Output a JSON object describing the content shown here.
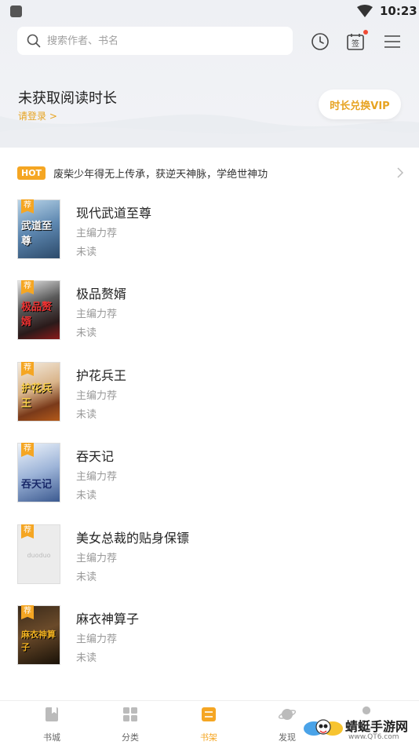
{
  "status_bar": {
    "time": "10:23"
  },
  "search": {
    "placeholder": "搜索作者、书名"
  },
  "checkin_icon_label": "签",
  "reading": {
    "title": "未获取阅读时长",
    "login": "请登录 >",
    "vip_button": "时长兑换VIP"
  },
  "hot": {
    "badge": "HOT",
    "text": "废柴少年得无上传承，获逆天神脉，学绝世神功"
  },
  "books": [
    {
      "title": "现代武道至尊",
      "subtitle": "主编力荐",
      "status": "未读",
      "tag": "荐",
      "cover_text": "武道至尊"
    },
    {
      "title": "极品赘婿",
      "subtitle": "主编力荐",
      "status": "未读",
      "tag": "荐",
      "cover_text": "极品赘婿"
    },
    {
      "title": "护花兵王",
      "subtitle": "主编力荐",
      "status": "未读",
      "tag": "荐",
      "cover_text": "护花兵王"
    },
    {
      "title": "吞天记",
      "subtitle": "主编力荐",
      "status": "未读",
      "tag": "荐",
      "cover_text": "吞天记"
    },
    {
      "title": "美女总裁的贴身保镖",
      "subtitle": "主编力荐",
      "status": "未读",
      "tag": "荐",
      "cover_text": "duoduo"
    },
    {
      "title": "麻衣神算子",
      "subtitle": "主编力荐",
      "status": "未读",
      "tag": "荐",
      "cover_text": "麻衣神算子"
    }
  ],
  "nav": [
    {
      "label": "书城",
      "icon": "book-icon"
    },
    {
      "label": "分类",
      "icon": "grid-icon"
    },
    {
      "label": "书架",
      "icon": "shelf-icon",
      "active": true
    },
    {
      "label": "发现",
      "icon": "planet-icon"
    },
    {
      "label": "",
      "icon": "user-icon"
    }
  ],
  "watermark": {
    "name": "蜻蜓手游网",
    "url": "www.QT6.com"
  },
  "colors": {
    "accent": "#f5a623",
    "hot_badge": "#f5a623",
    "text_primary": "#222222",
    "text_secondary": "#999999"
  }
}
